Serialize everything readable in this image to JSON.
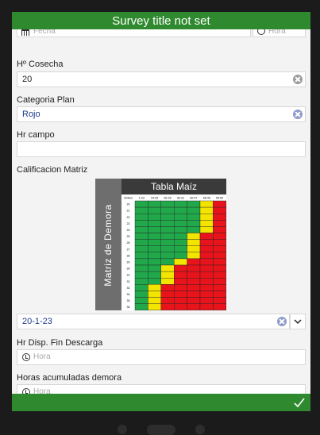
{
  "header": {
    "title": "Survey title not set"
  },
  "fields": {
    "fecha_placeholder": "Fecha",
    "hora_placeholder": "Hora",
    "cosecha_label": "Hº Cosecha",
    "cosecha_value": "20",
    "categoria_label": "Categoria Plan",
    "categoria_value": "Rojo",
    "hrcampo_label": "Hr campo",
    "hrcampo_value": "",
    "calificacion_label": "Calificacion Matriz",
    "calificacion_value": "20-1-23",
    "hrdisp_label": "Hr Disp. Fin Descarga",
    "hrdisp_placeholder": "Hora",
    "horasacum_label": "Horas acumuladas demora",
    "horasacum_placeholder": "Hora"
  },
  "matrix": {
    "title": "Tabla Maíz",
    "side_label": "Matriz de Demora",
    "corner_label": "Hr/Hvs",
    "columns": [
      "1-23",
      "24-25",
      "26-29",
      "30-31",
      "32-47",
      "48-49",
      "50-60"
    ],
    "rows": [
      "20",
      "21",
      "22",
      "23",
      "24",
      "25",
      "26",
      "27",
      "28",
      "29",
      "30",
      "31",
      "32",
      "33",
      "34",
      "35",
      "36"
    ],
    "colors": {
      "green": "#21a84a",
      "yellow": "#f3e500",
      "red": "#e8131b"
    }
  },
  "footer": {
    "submit_icon": "check-icon"
  }
}
